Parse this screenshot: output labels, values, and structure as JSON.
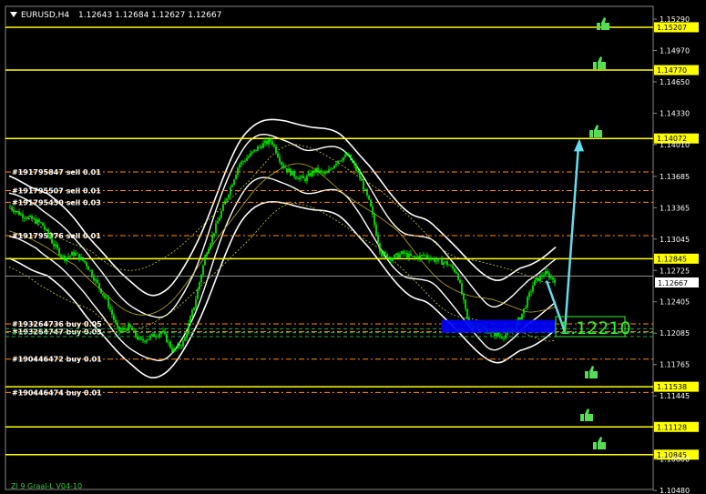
{
  "header": {
    "symbol": "EURUSD,H4",
    "ohlc": "1.12643 1.12684 1.12627 1.12667"
  },
  "footer": {
    "indicator_name": "ZI 9 Graal-L  V04-10"
  },
  "big_price_label": "1.12210",
  "current_price": "1.12667",
  "colors": {
    "background": "#000000",
    "candles": "#00ff00",
    "level_lines": "#ffff00",
    "bands": "#ffffff",
    "buy_zone": "#0000ff",
    "arrow": "#66ddee",
    "order_lines": "#ff8c00",
    "sell_order_lines": "#ff8c00",
    "buy_order_lines": "#ff8c00",
    "thumb_icons": "#55dd55"
  },
  "chart_data": {
    "type": "candlestick",
    "title": "EURUSD,H4",
    "ylim": [
      1.1049,
      1.1542
    ],
    "y_ticks": [
      "1.15290",
      "1.14970",
      "1.14650",
      "1.14330",
      "1.14010",
      "1.13685",
      "1.13365",
      "1.13045",
      "1.12725",
      "1.12405",
      "1.12085",
      "1.11765",
      "1.11445",
      "1.10800",
      "1.10480"
    ],
    "horizontal_levels": [
      {
        "label": "1.15207",
        "value": 1.15207
      },
      {
        "label": "1.14770",
        "value": 1.1477
      },
      {
        "label": "1.14072",
        "value": 1.14072
      },
      {
        "label": "1.12845",
        "value": 1.12845
      },
      {
        "label": "1.11538",
        "value": 1.11538
      },
      {
        "label": "1.11128",
        "value": 1.11128
      },
      {
        "label": "1.10845",
        "value": 1.10845
      }
    ],
    "orders": [
      {
        "label": "#191795847 sell 0.01",
        "value": 1.1373
      },
      {
        "label": "#191795507 sell 0.01",
        "value": 1.1354
      },
      {
        "label": "#191795450 sell 0.03",
        "value": 1.1342
      },
      {
        "label": "#191795376 sell 0.01",
        "value": 1.1308
      },
      {
        "label": "#193264736 buy 0.05",
        "value": 1.1218
      },
      {
        "label": "#193264747 buy 0.03",
        "value": 1.121
      },
      {
        "label": "#190446472 buy 0.01",
        "value": 1.1182
      },
      {
        "label": "#190446474 buy 0.01",
        "value": 1.1148
      }
    ],
    "close_path": [
      [
        0,
        1.1338
      ],
      [
        12,
        1.133
      ],
      [
        24,
        1.1325
      ],
      [
        36,
        1.132
      ],
      [
        48,
        1.13
      ],
      [
        60,
        1.1285
      ],
      [
        72,
        1.129
      ],
      [
        84,
        1.128
      ],
      [
        96,
        1.126
      ],
      [
        108,
        1.124
      ],
      [
        120,
        1.121
      ],
      [
        132,
        1.1215
      ],
      [
        144,
        1.12
      ],
      [
        156,
        1.1205
      ],
      [
        168,
        1.121
      ],
      [
        180,
        1.119
      ],
      [
        192,
        1.12
      ],
      [
        204,
        1.124
      ],
      [
        216,
        1.129
      ],
      [
        228,
        1.132
      ],
      [
        240,
        1.135
      ],
      [
        252,
        1.138
      ],
      [
        264,
        1.139
      ],
      [
        276,
        1.14
      ],
      [
        288,
        1.1405
      ],
      [
        300,
        1.138
      ],
      [
        312,
        1.137
      ],
      [
        324,
        1.1365
      ],
      [
        336,
        1.1375
      ],
      [
        348,
        1.137
      ],
      [
        360,
        1.1385
      ],
      [
        372,
        1.139
      ],
      [
        384,
        1.137
      ],
      [
        396,
        1.134
      ],
      [
        408,
        1.129
      ],
      [
        420,
        1.1285
      ],
      [
        432,
        1.129
      ],
      [
        444,
        1.1285
      ],
      [
        456,
        1.1288
      ],
      [
        468,
        1.1283
      ],
      [
        480,
        1.128
      ],
      [
        492,
        1.127
      ],
      [
        504,
        1.1218
      ],
      [
        516,
        1.1215
      ],
      [
        528,
        1.121
      ],
      [
        540,
        1.1205
      ],
      [
        552,
        1.121
      ],
      [
        564,
        1.123
      ],
      [
        576,
        1.126
      ],
      [
        588,
        1.127
      ],
      [
        600,
        1.1262
      ],
      [
        610,
        1.1267
      ]
    ],
    "buy_zone": {
      "y_top": 1.1222,
      "y_bottom": 1.1209
    },
    "arrow": {
      "from": 1.121,
      "to": 1.1407
    }
  }
}
